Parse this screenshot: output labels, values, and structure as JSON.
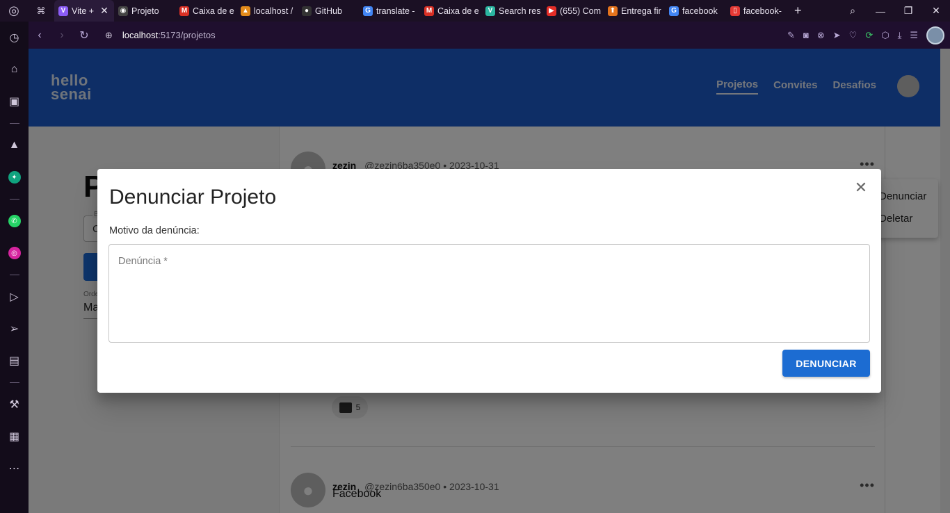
{
  "browser": {
    "tabs": [
      {
        "label": "Vite +",
        "active": true,
        "fav": "V",
        "color": "#8b5cf6"
      },
      {
        "label": "Projeto",
        "active": false,
        "fav": "◉",
        "color": "#444"
      },
      {
        "label": "Caixa de e",
        "active": false,
        "fav": "M",
        "color": "#d93025"
      },
      {
        "label": "localhost /",
        "active": false,
        "fav": "▲",
        "color": "#e38b1b"
      },
      {
        "label": "GitHub",
        "active": false,
        "fav": "●",
        "color": "#333"
      },
      {
        "label": "translate -",
        "active": false,
        "fav": "G",
        "color": "#4285f4"
      },
      {
        "label": "Caixa de e",
        "active": false,
        "fav": "M",
        "color": "#d93025"
      },
      {
        "label": "Search res",
        "active": false,
        "fav": "V",
        "color": "#2bb5a0"
      },
      {
        "label": "(655) Com",
        "active": false,
        "fav": "▶",
        "color": "#e52d27"
      },
      {
        "label": "Entrega fir",
        "active": false,
        "fav": "⬆",
        "color": "#e5741d"
      },
      {
        "label": "facebook",
        "active": false,
        "fav": "G",
        "color": "#4285f4"
      },
      {
        "label": "facebook-",
        "active": false,
        "fav": "▯",
        "color": "#e53935"
      }
    ],
    "url_host": "localhost",
    "url_path": ":5173/projetos"
  },
  "header": {
    "logo_line1": "hello",
    "logo_line2": "senai",
    "nav": [
      "Projetos",
      "Convites",
      "Desafios"
    ]
  },
  "leftpanel": {
    "title_char": "P",
    "search_label": "B",
    "search_value": "C",
    "order_label": "Orde",
    "order_value": "Ma"
  },
  "feed": {
    "post1": {
      "username": "zezin",
      "handle": "@zezin6ba350e0",
      "date": "2023-10-31",
      "comments": "5"
    },
    "post2": {
      "username": "zezin",
      "handle": "@zezin6ba350e0",
      "date": "2023-10-31",
      "text": "Facebook"
    }
  },
  "menu": {
    "items": [
      "Denunciar",
      "Deletar"
    ]
  },
  "dialog": {
    "title": "Denunciar Projeto",
    "label": "Motivo da denúncia:",
    "placeholder": "Denúncia *",
    "submit": "DENUNCIAR"
  }
}
